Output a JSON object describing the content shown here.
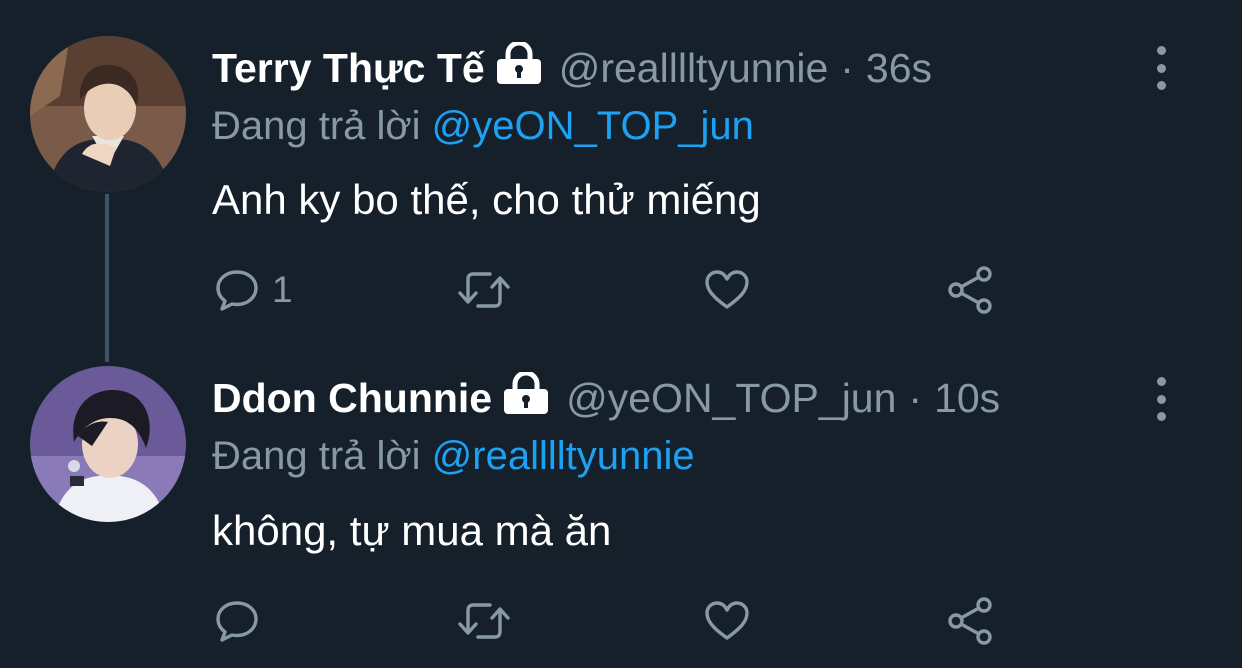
{
  "tweets": [
    {
      "display_name": "Terry Thực Tế",
      "handle": "@realllltyunnie",
      "separator": "·",
      "time": "36s",
      "reply_prefix": "Đang trả lời",
      "reply_to": "@yeON_TOP_jun",
      "text": "Anh ky bo thế, cho thử miếng",
      "reply_count": "1",
      "icons": [
        "reply-icon",
        "retweet-icon",
        "like-icon",
        "share-icon",
        "more-icon",
        "lock-icon"
      ]
    },
    {
      "display_name": "Ddon Chunnie",
      "handle": "@yeON_TOP_jun",
      "separator": "·",
      "time": "10s",
      "reply_prefix": "Đang trả lời",
      "reply_to": "@realllltyunnie",
      "text": "không, tự mua mà ăn",
      "reply_count": "",
      "icons": [
        "reply-icon",
        "retweet-icon",
        "like-icon",
        "share-icon",
        "more-icon",
        "lock-icon"
      ]
    }
  ],
  "colors": {
    "background": "#15202b",
    "muted": "#8899a6",
    "link": "#1da1f2",
    "thread_line": "#3d5466"
  }
}
